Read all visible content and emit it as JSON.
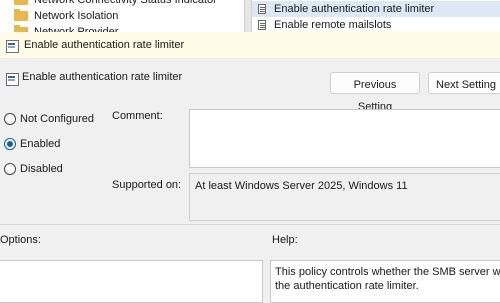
{
  "tree": {
    "items": [
      {
        "label": "Network Connectivity Status Indicator"
      },
      {
        "label": "Network Isolation"
      },
      {
        "label": "Network Provider"
      }
    ]
  },
  "list": {
    "items": [
      {
        "label": "Enable authentication rate limiter",
        "selected": true
      },
      {
        "label": "Enable remote mailslots",
        "selected": false
      }
    ]
  },
  "dialog": {
    "title": "Enable authentication rate limiter",
    "setting_name": "Enable authentication rate limiter",
    "buttons": {
      "previous": "Previous Setting",
      "next": "Next Setting"
    },
    "options": [
      {
        "label": "Not Configured",
        "checked": false
      },
      {
        "label": "Enabled",
        "checked": true
      },
      {
        "label": "Disabled",
        "checked": false
      }
    ],
    "comment_label": "Comment:",
    "comment_value": "",
    "supported_label": "Supported on:",
    "supported_value": "At least Windows Server 2025, Windows 11",
    "options_label": "Options:",
    "help_label": "Help:",
    "help_text": "This policy controls whether the SMB server will the authentication rate limiter."
  },
  "colors": {
    "titlebar_bg": "#fffbe6",
    "selected_bg": "#dde8f6",
    "radio_accent": "#0e5db8",
    "folder": "#e8b84a"
  },
  "icons": [
    "folder-icon",
    "policy-setting-icon",
    "policy-icon"
  ]
}
